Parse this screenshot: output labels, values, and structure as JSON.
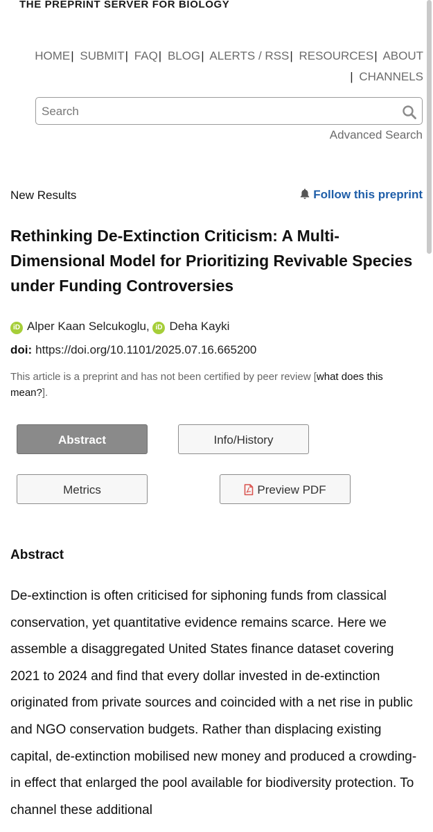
{
  "header": {
    "tagline": "THE PREPRINT SERVER FOR BIOLOGY",
    "nav": [
      "HOME",
      "SUBMIT",
      "FAQ",
      "BLOG",
      "ALERTS / RSS",
      "RESOURCES",
      "ABOUT",
      "CHANNELS"
    ],
    "search_placeholder": "Search",
    "advanced_search": "Advanced Search"
  },
  "article": {
    "type": "New Results",
    "follow_label": "Follow this preprint",
    "title": "Rethinking De-Extinction Criticism: A Multi-Dimensional Model for Prioritizing Revivable Species under Funding Controversies",
    "authors": [
      "Alper Kaan Selcukoglu",
      "Deha Kayki"
    ],
    "author_separator": ",",
    "doi_label": "doi:",
    "doi_url": "https://doi.org/10.1101/2025.07.16.665200",
    "disclaimer": "This article is a preprint and has not been certified by peer review",
    "disclaimer_link": "what does this mean?",
    "disclaimer_open": "[",
    "disclaimer_close": "]."
  },
  "tabs": {
    "abstract": "Abstract",
    "info_history": "Info/History",
    "metrics": "Metrics",
    "preview_pdf": "Preview PDF"
  },
  "abstract": {
    "heading": "Abstract",
    "text": "De-extinction is often criticised for siphoning funds from classical conservation, yet quantitative evidence remains scarce. Here we assemble a disaggregated United States finance dataset covering 2021 to 2024 and find that every dollar invested in de-extinction originated from private sources and coincided with a net rise in public and NGO conservation budgets. Rather than displacing existing capital, de-extinction mobilised new money and produced a crowding-in effect that enlarged the pool available for biodiversity protection. To channel these additional"
  },
  "colors": {
    "link_blue": "#1f5ea8",
    "orcid_green": "#a6ce39",
    "active_tab": "#8a8a8a",
    "pdf_icon": "#d9534f"
  },
  "icons": {
    "search": "search-icon",
    "bell": "bell-icon",
    "orcid": "orcid-icon",
    "pdf": "pdf-icon"
  }
}
